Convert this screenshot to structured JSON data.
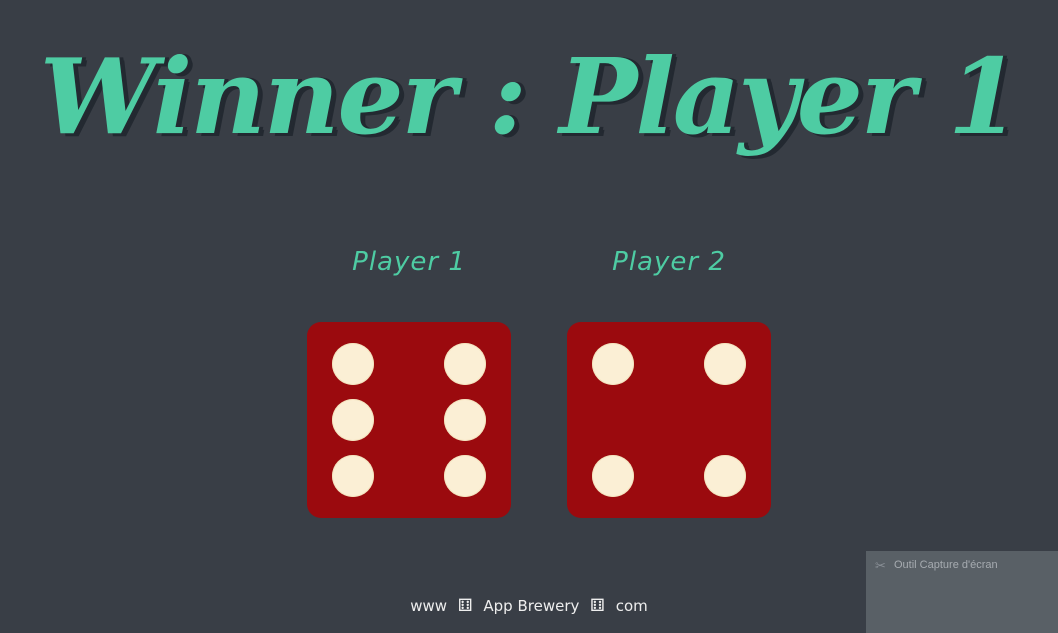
{
  "title": "Winner : Player 1",
  "players": [
    {
      "label": "Player 1",
      "die_value": 6
    },
    {
      "label": "Player 2",
      "die_value": 4
    }
  ],
  "footer": {
    "prefix": "www",
    "brand": "App Brewery",
    "suffix": "com",
    "separator_icon": "die-icon"
  },
  "overlay": {
    "label": "Outil Capture d'écran",
    "icon": "snipping-tool-icon"
  },
  "colors": {
    "background": "#393e46",
    "accent": "#4ecca3",
    "die_face": "#9b0a0e",
    "pip": "#fbefd5",
    "title_shadow": "#232931"
  }
}
